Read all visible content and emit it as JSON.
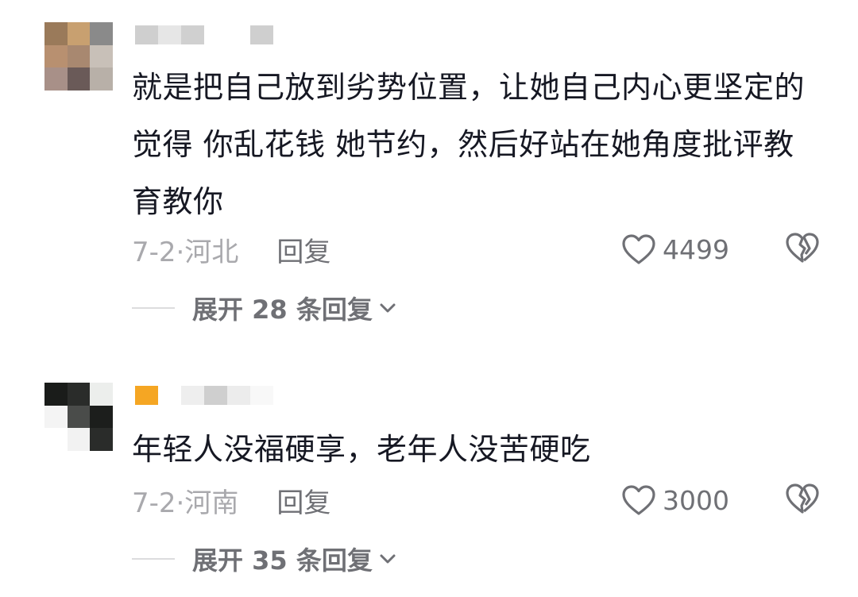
{
  "comments": [
    {
      "text": "就是把自己放到劣势位置，让她自己内心更坚定的觉得 你乱花钱 她节约，然后好站在她角度批评教育教你",
      "date_location": "7-2·河北",
      "reply_label": "回复",
      "likes": "4499",
      "expand_label": "展开 28 条回复",
      "avatar_colors": [
        "#9a7a5a",
        "#c8a070",
        "#8a8a8a",
        "#b89070",
        "#a88870",
        "#c8c0b8",
        "#a89088",
        "#6a5a58",
        "#b8b0a8"
      ],
      "name_blocks": [
        "#cfcfcf",
        "#e6e6e6",
        "#d0d0d0",
        "#ffffff",
        "#ffffff",
        "#cfcfcf"
      ]
    },
    {
      "text": "年轻人没福硬享，老年人没苦硬吃",
      "date_location": "7-2·河南",
      "reply_label": "回复",
      "likes": "3000",
      "expand_label": "展开 35 条回复",
      "avatar_colors": [
        "#1a1c1a",
        "#2a2c2a",
        "#eceeec",
        "#f4f4f4",
        "#4a4c4a",
        "#1c1e1c",
        "#ffffff",
        "#f2f2f2",
        "#2a2c2a"
      ],
      "name_blocks": [
        "#f5a623",
        "#ffffff",
        "#eeeeee",
        "#cfcfcf",
        "#ececec",
        "#f8f8f8"
      ]
    }
  ],
  "icons": {
    "like": "heart-outline-icon",
    "dislike": "broken-heart-icon",
    "expand": "chevron-down-icon"
  }
}
